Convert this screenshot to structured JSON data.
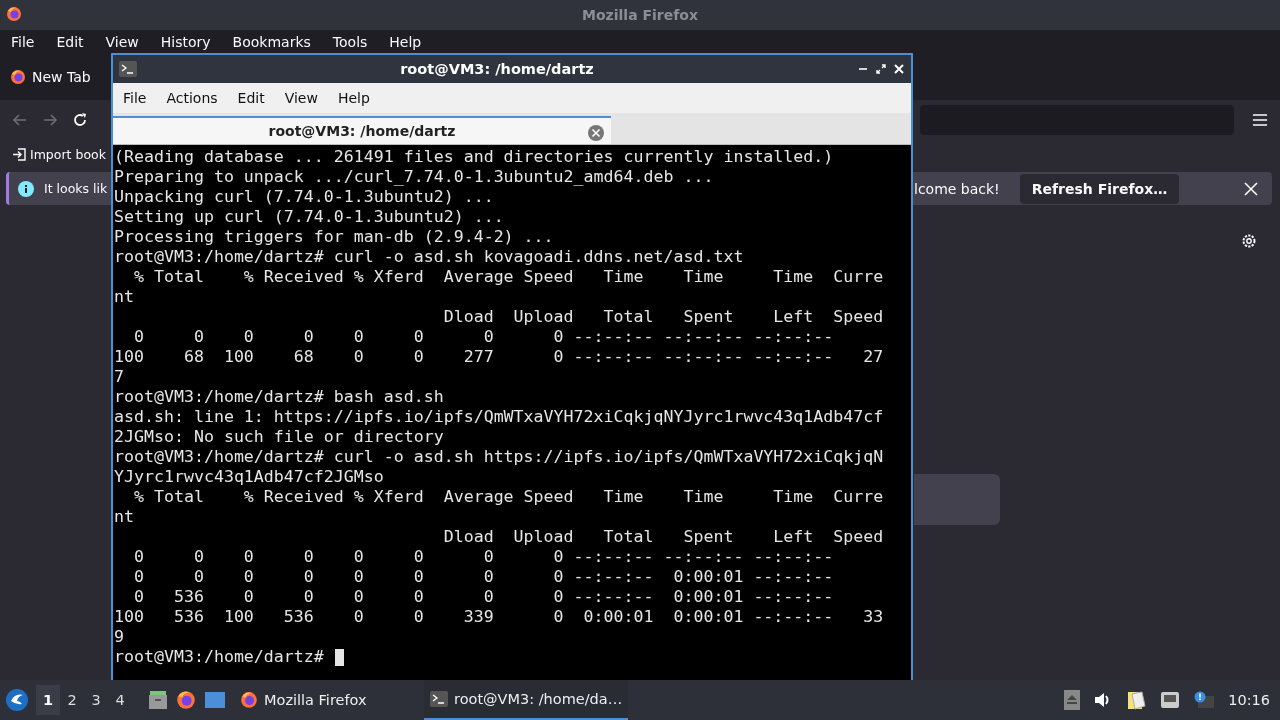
{
  "firefox": {
    "title": "Mozilla Firefox",
    "menu": [
      "File",
      "Edit",
      "View",
      "History",
      "Bookmarks",
      "Tools",
      "Help"
    ],
    "tab": {
      "label": "New Tab"
    },
    "bookmarks": [
      "Import book"
    ],
    "notification": {
      "message_start": "It looks lik",
      "message_end": "lcome back!",
      "button": "Refresh Firefox…"
    }
  },
  "terminal": {
    "title": "root@VM3: /home/dartz",
    "menu": [
      "File",
      "Actions",
      "Edit",
      "View",
      "Help"
    ],
    "tabs": [
      {
        "label": "root@VM3: /home/dartz",
        "selected": true
      }
    ],
    "lines": [
      "(Reading database ... 261491 files and directories currently installed.)",
      "Preparing to unpack .../curl_7.74.0-1.3ubuntu2_amd64.deb ...",
      "Unpacking curl (7.74.0-1.3ubuntu2) ...",
      "Setting up curl (7.74.0-1.3ubuntu2) ...",
      "Processing triggers for man-db (2.9.4-2) ...",
      "root@VM3:/home/dartz# curl -o asd.sh kovagoadi.ddns.net/asd.txt",
      "  % Total    % Received % Xferd  Average Speed   Time    Time     Time  Curre",
      "nt",
      "                                 Dload  Upload   Total   Spent    Left  Speed",
      "  0     0    0     0    0     0      0      0 --:--:-- --:--:-- --:--:--",
      "100    68  100    68    0     0    277      0 --:--:-- --:--:-- --:--:--   27",
      "7",
      "root@VM3:/home/dartz# bash asd.sh",
      "asd.sh: line 1: https://ipfs.io/ipfs/QmWTxaVYH72xiCqkjqNYJyrc1rwvc43q1Adb47cf",
      "2JGMso: No such file or directory",
      "root@VM3:/home/dartz# curl -o asd.sh https://ipfs.io/ipfs/QmWTxaVYH72xiCqkjqN",
      "YJyrc1rwvc43q1Adb47cf2JGMso",
      "  % Total    % Received % Xferd  Average Speed   Time    Time     Time  Curre",
      "nt",
      "                                 Dload  Upload   Total   Spent    Left  Speed",
      "  0     0    0     0    0     0      0      0 --:--:-- --:--:-- --:--:--",
      "  0     0    0     0    0     0      0      0 --:--:--  0:00:01 --:--:--",
      "  0   536    0     0    0     0      0      0 --:--:--  0:00:01 --:--:--",
      "100   536  100   536    0     0    339      0  0:00:01  0:00:01 --:--:--   33",
      "9"
    ],
    "prompt": "root@VM3:/home/dartz#"
  },
  "taskbar": {
    "workspaces": [
      {
        "label": "1",
        "selected": true
      },
      {
        "label": "2",
        "selected": false
      },
      {
        "label": "3",
        "selected": false
      },
      {
        "label": "4",
        "selected": false
      }
    ],
    "tasks": [
      {
        "kind": "browser",
        "label": "Mozilla Firefox",
        "selected": false
      },
      {
        "kind": "terminal",
        "label": "root@VM3: /home/da…",
        "selected": true
      }
    ],
    "clock": "10:16"
  }
}
